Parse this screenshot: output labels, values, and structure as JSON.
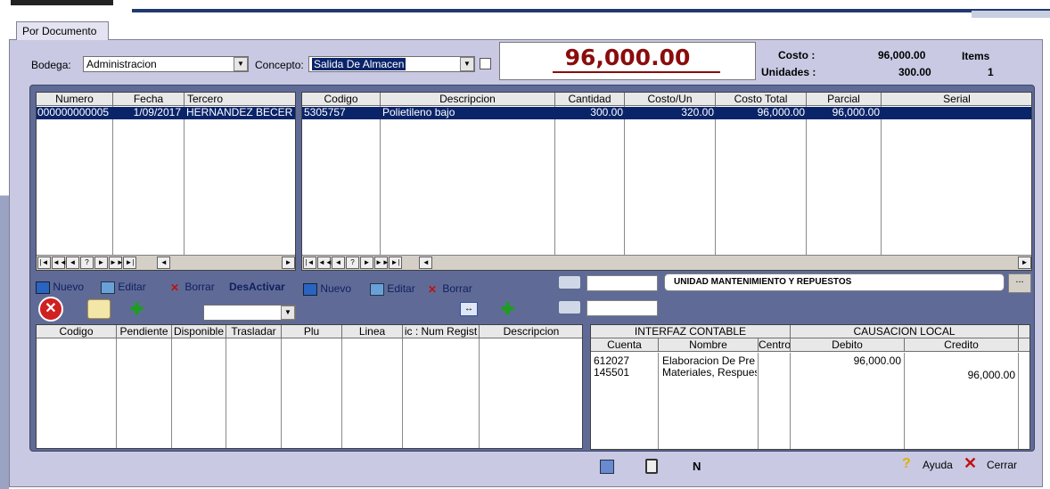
{
  "tab": {
    "label": "Por Documento"
  },
  "header": {
    "bodega_label": "Bodega:",
    "bodega_value": "Administracion",
    "concepto_label": "Concepto:",
    "concepto_value": "Salida De Almacen",
    "total_value": "96,000.00",
    "costo_label": "Costo :",
    "costo_value": "96,000.00",
    "unidades_label": "Unidades :",
    "unidades_value": "300.00",
    "items_label": "Items",
    "items_value": "1"
  },
  "docs_grid": {
    "columns": [
      "Numero",
      "Fecha",
      "Tercero"
    ],
    "rows": [
      [
        "000000000005",
        "1/09/2017",
        "HERNANDEZ BECER"
      ]
    ]
  },
  "items_grid": {
    "columns": [
      "Codigo",
      "Descripcion",
      "Cantidad",
      "Costo/Un",
      "Costo Total",
      "Parcial",
      "Serial"
    ],
    "rows": [
      [
        "5305757",
        "Polietileno bajo",
        "300.00",
        "320.00",
        "96,000.00",
        "96,000.00",
        ""
      ]
    ]
  },
  "nav_symbols": [
    "|◄",
    "◄◄",
    "◄",
    "?",
    "►",
    "►►",
    "►|"
  ],
  "actions_left": {
    "nuevo": "Nuevo",
    "editar": "Editar",
    "borrar": "Borrar",
    "desactivar": "DesActivar"
  },
  "actions_right": {
    "nuevo": "Nuevo",
    "editar": "Editar",
    "borrar": "Borrar"
  },
  "unidad_text": "UNIDAD MANTENIMIENTO Y REPUESTOS",
  "ellipsis": "...",
  "lower_grid": {
    "columns": [
      "Codigo",
      "Pendiente",
      "Disponible",
      "Trasladar",
      "Plu",
      "Linea",
      "ic : Num Regist",
      "Descripcion"
    ]
  },
  "interfaz": {
    "group1": "INTERFAZ CONTABLE",
    "group2": "CAUSACION LOCAL",
    "columns": [
      "Cuenta",
      "Nombre",
      "Centro",
      "Debito",
      "Credito"
    ],
    "rows": [
      [
        "612027",
        "Elaboracion De Pre",
        "",
        "96,000.00",
        ""
      ],
      [
        "145501",
        "Materiales, Respues",
        "",
        "",
        "96,000.00"
      ]
    ]
  },
  "footer": {
    "n_label": "N",
    "ayuda": "Ayuda",
    "cerrar": "Cerrar"
  },
  "colors": {
    "selection": "#0a246a",
    "total_red": "#8b0c0c",
    "panel": "#5f6b96"
  }
}
